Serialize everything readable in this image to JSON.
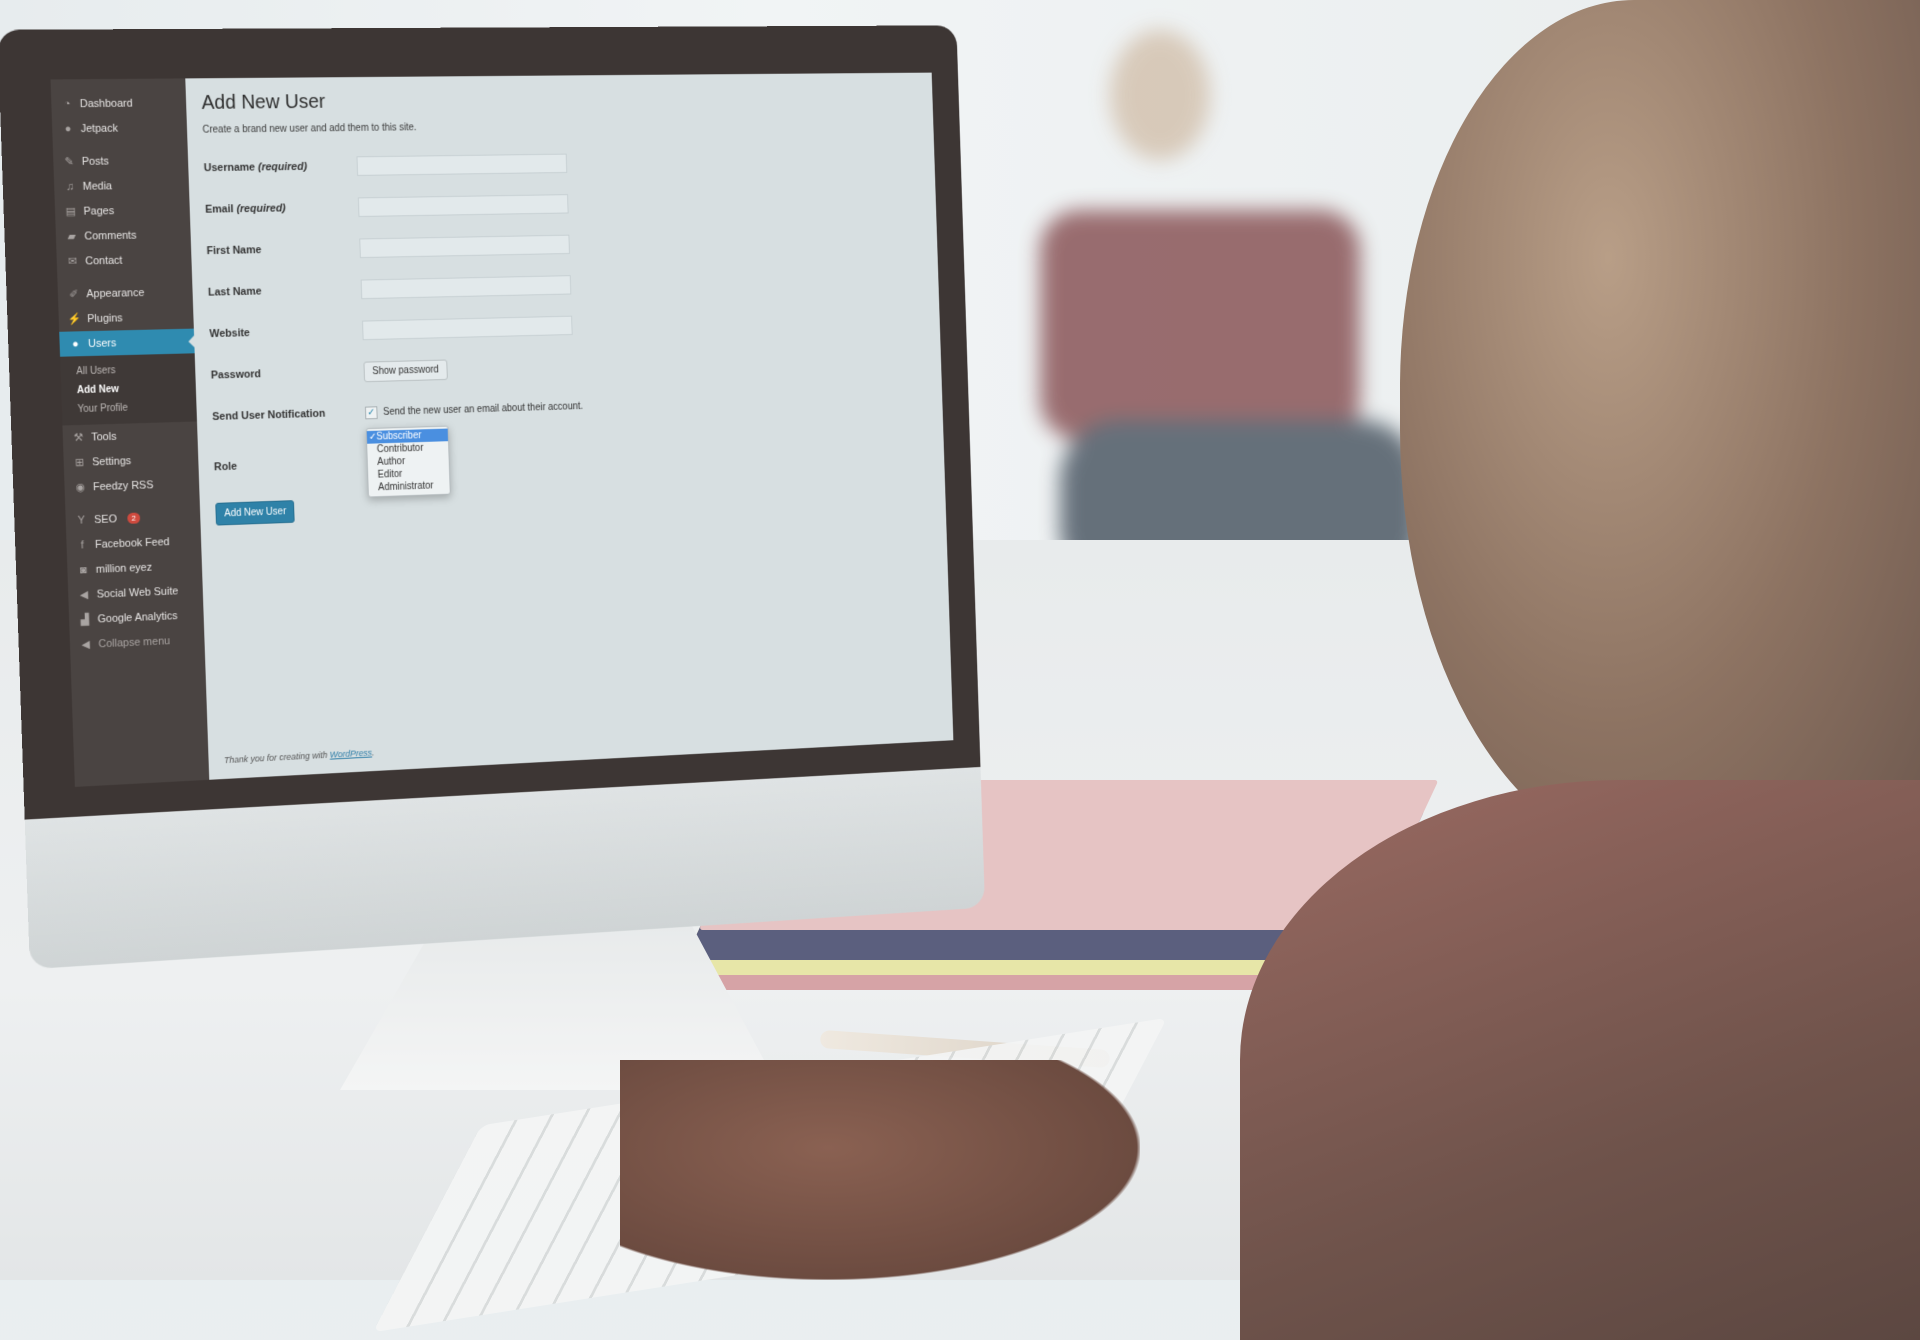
{
  "sidebar": {
    "items": [
      {
        "label": "Dashboard",
        "icon": "dashboard-icon"
      },
      {
        "label": "Jetpack",
        "icon": "jetpack-icon"
      },
      {
        "label": "Posts",
        "icon": "pin-icon"
      },
      {
        "label": "Media",
        "icon": "media-icon"
      },
      {
        "label": "Pages",
        "icon": "pages-icon"
      },
      {
        "label": "Comments",
        "icon": "comment-icon"
      },
      {
        "label": "Contact",
        "icon": "envelope-icon"
      },
      {
        "label": "Appearance",
        "icon": "paintbrush-icon"
      },
      {
        "label": "Plugins",
        "icon": "plug-icon"
      },
      {
        "label": "Users",
        "icon": "user-icon",
        "active": true
      },
      {
        "label": "Tools",
        "icon": "wrench-icon"
      },
      {
        "label": "Settings",
        "icon": "settings-icon"
      },
      {
        "label": "Feedzy RSS",
        "icon": "rss-icon"
      },
      {
        "label": "SEO",
        "icon": "seo-icon",
        "badge": "2"
      },
      {
        "label": "Facebook Feed",
        "icon": "facebook-icon"
      },
      {
        "label": "million eyez",
        "icon": "camera-icon"
      },
      {
        "label": "Social Web Suite",
        "icon": "megaphone-icon"
      },
      {
        "label": "Google Analytics",
        "icon": "chart-icon"
      },
      {
        "label": "Collapse menu",
        "icon": "collapse-icon"
      }
    ],
    "users_submenu": [
      "All Users",
      "Add New",
      "Your Profile"
    ],
    "current_submenu": "Add New"
  },
  "page": {
    "title": "Add New User",
    "intro": "Create a brand new user and add them to this site.",
    "fields": [
      {
        "label": "Username",
        "suffix": "(required)",
        "value": ""
      },
      {
        "label": "Email",
        "suffix": "(required)",
        "value": ""
      },
      {
        "label": "First Name",
        "suffix": "",
        "value": ""
      },
      {
        "label": "Last Name",
        "suffix": "",
        "value": ""
      },
      {
        "label": "Website",
        "suffix": "",
        "value": ""
      }
    ],
    "password_label": "Password",
    "show_password_button": "Show password",
    "notification_label": "Send User Notification",
    "notification_text": "Send the new user an email about their account.",
    "notification_checked": true,
    "role_label": "Role",
    "role_options": [
      "Subscriber",
      "Contributor",
      "Author",
      "Editor",
      "Administrator"
    ],
    "role_selected": "Subscriber",
    "submit_button": "Add New User",
    "footer_prefix": "Thank you for creating with ",
    "footer_link": "WordPress",
    "footer_suffix": "."
  },
  "colors": {
    "sidebar_bg": "#4a4442",
    "accent": "#2f8bb0",
    "badge": "#cf4a3e",
    "screen_bg": "#d7dfe1"
  }
}
